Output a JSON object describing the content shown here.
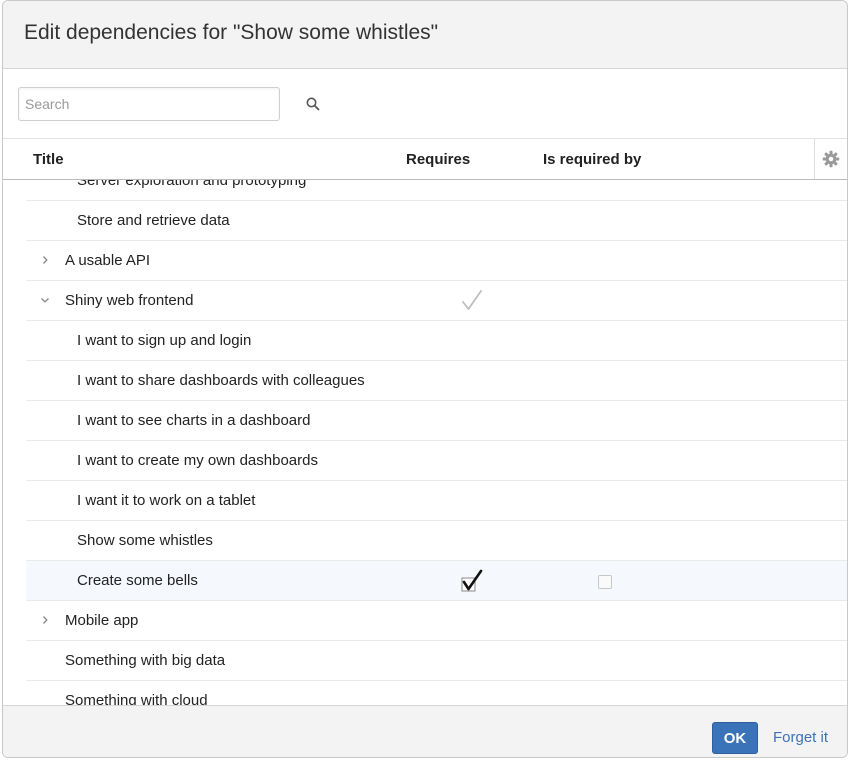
{
  "dialog": {
    "title": "Edit dependencies for \"Show some whistles\""
  },
  "search": {
    "placeholder": "Search",
    "value": ""
  },
  "columns": {
    "title": "Title",
    "requires": "Requires",
    "required_by": "Is required by"
  },
  "rows": [
    {
      "title": "Server exploration and prototyping",
      "level": 2,
      "toggle": null,
      "requires": null,
      "required_by": null
    },
    {
      "title": "Store and retrieve data",
      "level": 2,
      "toggle": null,
      "requires": null,
      "required_by": null
    },
    {
      "title": "A usable API",
      "level": 1,
      "toggle": "collapsed",
      "requires": null,
      "required_by": null
    },
    {
      "title": "Shiny web frontend",
      "level": 1,
      "toggle": "expanded",
      "requires": "partial",
      "required_by": null
    },
    {
      "title": "I want to sign up and login",
      "level": 2,
      "toggle": null,
      "requires": null,
      "required_by": null
    },
    {
      "title": "I want to share dashboards with colleagues",
      "level": 2,
      "toggle": null,
      "requires": null,
      "required_by": null
    },
    {
      "title": "I want to see charts in a dashboard",
      "level": 2,
      "toggle": null,
      "requires": null,
      "required_by": null
    },
    {
      "title": "I want to create my own dashboards",
      "level": 2,
      "toggle": null,
      "requires": null,
      "required_by": null
    },
    {
      "title": "I want it to work on a tablet",
      "level": 2,
      "toggle": null,
      "requires": null,
      "required_by": null
    },
    {
      "title": "Show some whistles",
      "level": 2,
      "toggle": null,
      "requires": null,
      "required_by": null
    },
    {
      "title": "Create some bells",
      "level": 2,
      "toggle": null,
      "requires": "checked",
      "required_by": "unchecked",
      "highlighted": true
    },
    {
      "title": "Mobile app",
      "level": 1,
      "toggle": "collapsed",
      "requires": null,
      "required_by": null
    },
    {
      "title": "Something with big data",
      "level": 1,
      "toggle": null,
      "requires": null,
      "required_by": null
    },
    {
      "title": "Something with cloud",
      "level": 1,
      "toggle": null,
      "requires": null,
      "required_by": null
    }
  ],
  "footer": {
    "ok_label": "OK",
    "cancel_label": "Forget it"
  },
  "icons": {
    "search": "search-icon",
    "settings": "gear-icon",
    "expand": "chevron-right-icon",
    "collapse": "chevron-down-icon",
    "check": "checkmark-icon"
  },
  "colors": {
    "accent": "#3b73b9",
    "header_bg": "#f3f3f3",
    "highlight_row": "#f5f8fc"
  }
}
